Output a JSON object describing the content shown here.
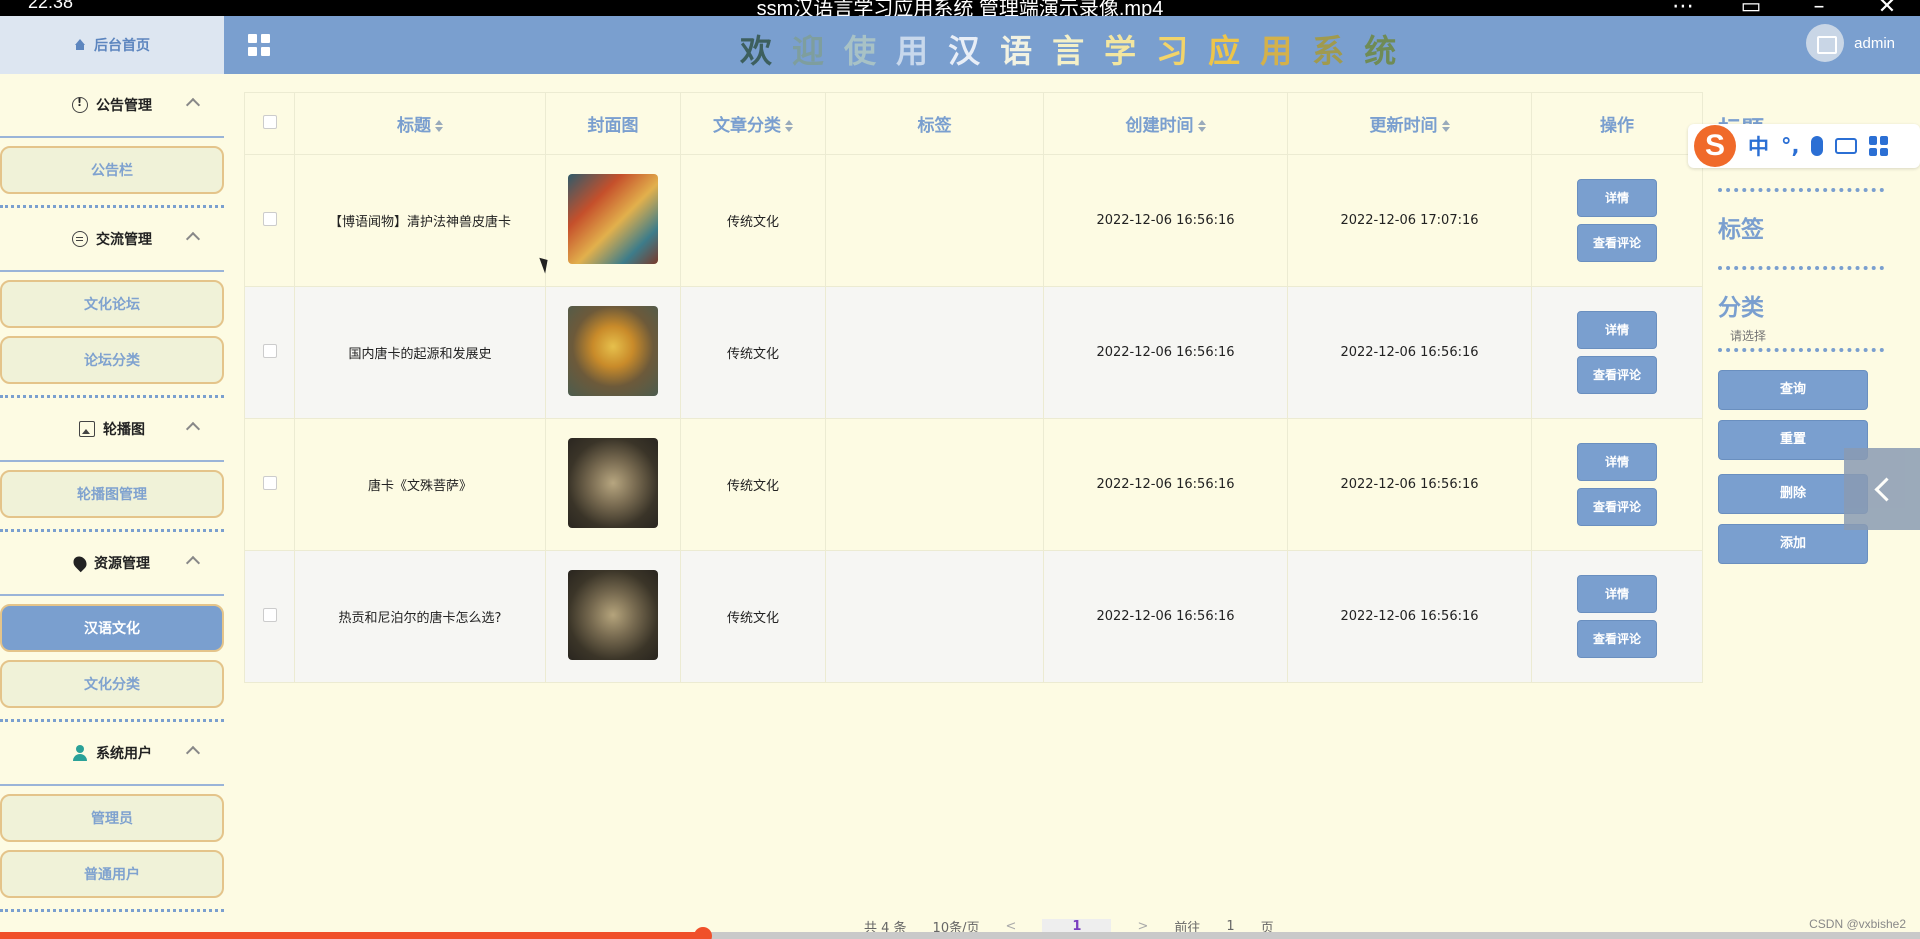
{
  "player": {
    "clock": "22:38",
    "title": "ssm汉语言学习应用系统 管理端演示录像.mp4",
    "progress": 0.366
  },
  "header": {
    "home_label": "后台首页",
    "title_chars": [
      {
        "ch": "欢",
        "color": "#3d5f5e"
      },
      {
        "ch": "迎",
        "color": "#7e9e9e"
      },
      {
        "ch": "使",
        "color": "#a8c2c6"
      },
      {
        "ch": "用",
        "color": "#c8d8ec"
      },
      {
        "ch": "汉",
        "color": "#e8eef7"
      },
      {
        "ch": "语",
        "color": "#f2f2e2"
      },
      {
        "ch": "言",
        "color": "#f4f0c8"
      },
      {
        "ch": "学",
        "color": "#f3e6a0"
      },
      {
        "ch": "习",
        "color": "#f2d46a"
      },
      {
        "ch": "应",
        "color": "#eec549"
      },
      {
        "ch": "用",
        "color": "#d4b14a"
      },
      {
        "ch": "系",
        "color": "#a09a4e"
      },
      {
        "ch": "统",
        "color": "#6f8b55"
      }
    ],
    "user": "admin"
  },
  "sidebar": {
    "groups": [
      {
        "label": "公告管理",
        "icon": "notice-icon",
        "items": [
          "公告栏"
        ]
      },
      {
        "label": "交流管理",
        "icon": "chat-icon",
        "items": [
          "文化论坛",
          "论坛分类"
        ]
      },
      {
        "label": "轮播图",
        "icon": "image-icon",
        "items": [
          "轮播图管理"
        ]
      },
      {
        "label": "资源管理",
        "icon": "location-pin-icon",
        "items": [
          "汉语文化",
          "文化分类"
        ]
      },
      {
        "label": "系统用户",
        "icon": "user-icon",
        "items": [
          "管理员",
          "普通用户"
        ]
      }
    ],
    "active_item": "汉语文化"
  },
  "table": {
    "headers": [
      "标题",
      "封面图",
      "文章分类",
      "标签",
      "创建时间",
      "更新时间",
      "操作"
    ],
    "rows": [
      {
        "title": "【博语闻物】清护法神兽皮唐卡",
        "category": "传统文化",
        "tag": "",
        "created": "2022-12-06 16:56:16",
        "updated": "2022-12-06 17:07:16"
      },
      {
        "title": "国内唐卡的起源和发展史",
        "category": "传统文化",
        "tag": "",
        "created": "2022-12-06 16:56:16",
        "updated": "2022-12-06 16:56:16"
      },
      {
        "title": "唐卡《文殊菩萨》",
        "category": "传统文化",
        "tag": "",
        "created": "2022-12-06 16:56:16",
        "updated": "2022-12-06 16:56:16"
      },
      {
        "title": "热贡和尼泊尔的唐卡怎么选?",
        "category": "传统文化",
        "tag": "",
        "created": "2022-12-06 16:56:16",
        "updated": "2022-12-06 16:56:16"
      }
    ],
    "btn_detail": "详情",
    "btn_comment": "查看评论"
  },
  "panel": {
    "title_label": "标题",
    "tag_label": "标签",
    "category_label": "分类",
    "category_placeholder": "请选择",
    "btn_query": "查询",
    "btn_reset": "重置",
    "btn_delete": "删除",
    "btn_add": "添加"
  },
  "ime": {
    "zh": "中",
    "punct": "°,"
  },
  "pager": {
    "total": "共 4 条",
    "size": "10条/页",
    "prev": "<",
    "page": "1",
    "next": ">",
    "goto": "前往",
    "goto_val": "1",
    "unit": "页"
  },
  "watermark": "CSDN @vxbishe2"
}
